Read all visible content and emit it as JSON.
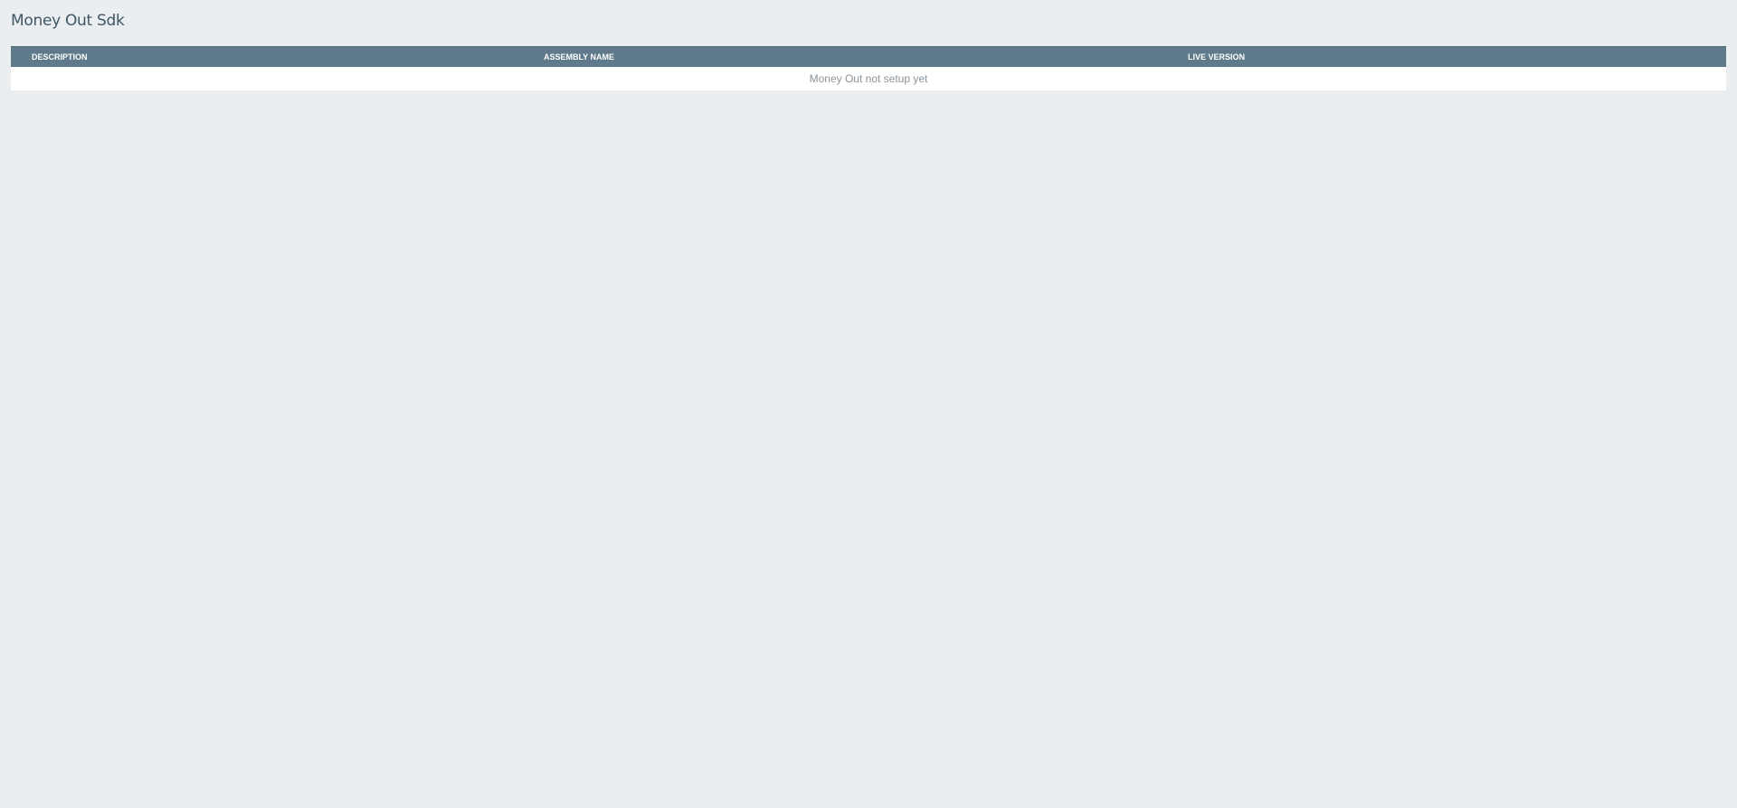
{
  "page": {
    "title": "Money Out Sdk"
  },
  "table": {
    "columns": [
      "DESCRIPTION",
      "ASSEMBLY NAME",
      "LIVE VERSION"
    ],
    "empty_message": "Money Out not setup yet"
  },
  "colors": {
    "background": "#eaeef1",
    "header_bg": "#5f7b8b",
    "title_text": "#3f5665",
    "empty_text": "#8a949b"
  }
}
